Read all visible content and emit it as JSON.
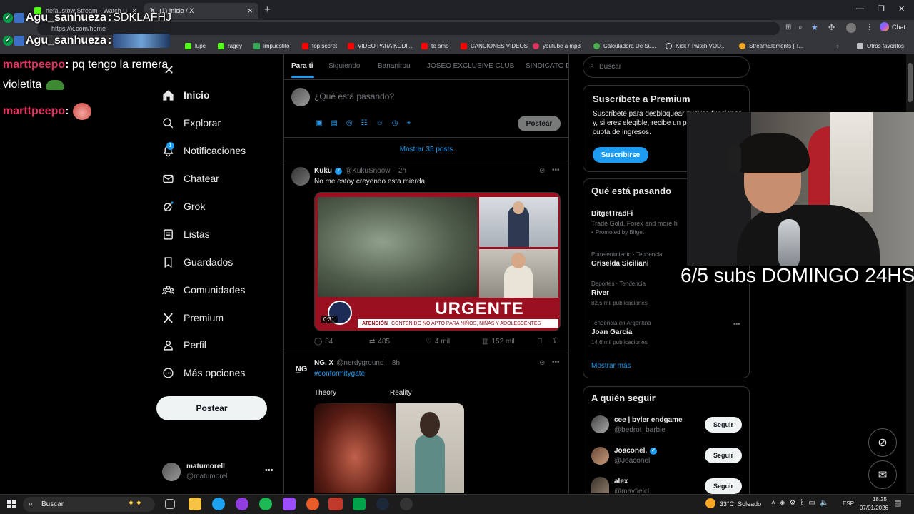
{
  "browser": {
    "tabs": [
      {
        "label": "nefaustow Stream - Watch Li"
      },
      {
        "label": "(1) Inicio / X"
      }
    ],
    "url": "https://x.com/home",
    "chat_label": "Chat",
    "bookmarks": [
      "lupe",
      "ragey",
      "impuestito",
      "top secret",
      "VIDEO PARA KODI...",
      "te amo",
      "CANCIONES VIDEOS",
      "youtube a mp3",
      "Calculadora De Su...",
      "Kick / Twitch VOD...",
      "StreamElements | T..."
    ],
    "other_bookmarks": "Otros favoritos"
  },
  "stream_chat": [
    {
      "user": "Agu_sanhueza",
      "message": "SDKLAFHJ"
    },
    {
      "user": "Agu_sanhueza",
      "message": ""
    },
    {
      "user": "marttpeepo",
      "message": "pq tengo la remera"
    },
    {
      "user": "",
      "message": "violetita"
    },
    {
      "user": "marttpeepo",
      "message": ""
    }
  ],
  "overlay_text": "6/5 subs DOMINGO 24HS",
  "sidebar": {
    "items": [
      {
        "label": "Inicio",
        "icon": "home-icon"
      },
      {
        "label": "Explorar",
        "icon": "search-icon"
      },
      {
        "label": "Notificaciones",
        "icon": "bell-icon",
        "badge": "1"
      },
      {
        "label": "Chatear",
        "icon": "mail-icon"
      },
      {
        "label": "Grok",
        "icon": "grok-icon"
      },
      {
        "label": "Listas",
        "icon": "list-icon"
      },
      {
        "label": "Guardados",
        "icon": "bookmark-icon"
      },
      {
        "label": "Comunidades",
        "icon": "people-icon"
      },
      {
        "label": "Premium",
        "icon": "x-logo-icon"
      },
      {
        "label": "Perfil",
        "icon": "person-icon"
      },
      {
        "label": "Más opciones",
        "icon": "more-circle-icon"
      }
    ],
    "post_button": "Postear",
    "account": {
      "name": "matumorell",
      "handle": "@matumorell"
    }
  },
  "timeline": {
    "tabs": [
      "Para ti",
      "Siguiendo",
      "Bananirou",
      "JOSEO EXCLUSIVE CLUB",
      "SINDICATO D"
    ],
    "composer_placeholder": "¿Qué está pasando?",
    "composer_button": "Postear",
    "show_more": "Mostrar 35 posts",
    "posts": [
      {
        "author": "Kuku",
        "handle": "@KukuSnoow",
        "time": "2h",
        "text": "No me estoy creyendo esta mierda",
        "media_banner": "URGENTE",
        "media_ticker_label": "ATENCIÓN",
        "media_ticker": "CONTENIDO NO APTO PARA NIÑOS, NIÑAS Y ADOLESCENTES",
        "video_duration": "0:31",
        "replies": "84",
        "reposts": "485",
        "likes": "4 mil",
        "views": "152 mil"
      },
      {
        "author": "NG. X",
        "handle": "@nerdyground",
        "time": "8h",
        "hashtag": "#conformitygate",
        "caption_left": "Theory",
        "caption_right": "Reality"
      }
    ]
  },
  "right": {
    "search_placeholder": "Buscar",
    "premium": {
      "title": "Suscríbete a Premium",
      "body": "Suscríbete para desbloquear nuevas funciones y, si eres elegible, recibe un porcentaje de cuota de ingresos.",
      "button": "Suscribirse"
    },
    "trends_title": "Qué está pasando",
    "trends": [
      {
        "meta": "",
        "name": "BitgetTradFi",
        "sub": "Trade Gold, Forex and more h",
        "extra": "Promoted by Bitget"
      },
      {
        "meta": "Entretenimiento · Tendencia",
        "name": "Griselda Siciliani",
        "sub": ""
      },
      {
        "meta": "Deportes · Tendencia",
        "name": "River",
        "sub": "82,5 mil publicaciones"
      },
      {
        "meta": "Tendencia en Argentina",
        "name": "Joan Garcia",
        "sub": "14,6 mil publicaciones"
      }
    ],
    "show_more": "Mostrar más",
    "follow_title": "A quién seguir",
    "follow": [
      {
        "name": "cee | byler endgame",
        "handle": "@bedrot_barbie",
        "button": "Seguir"
      },
      {
        "name": "Joaconel.",
        "handle": "@Joaconel",
        "button": "Seguir"
      },
      {
        "name": "alex",
        "handle": "@mayfielcl",
        "button": "Seguir"
      }
    ]
  },
  "taskbar": {
    "search": "Buscar",
    "weather": "33°C  Soleado",
    "lang": "ESP",
    "time": "18:25",
    "date": "07/01/2026"
  },
  "colors": {
    "accent": "#1d9bf0",
    "chat_name": "#e0325f",
    "urgent_red": "#d0021b"
  }
}
